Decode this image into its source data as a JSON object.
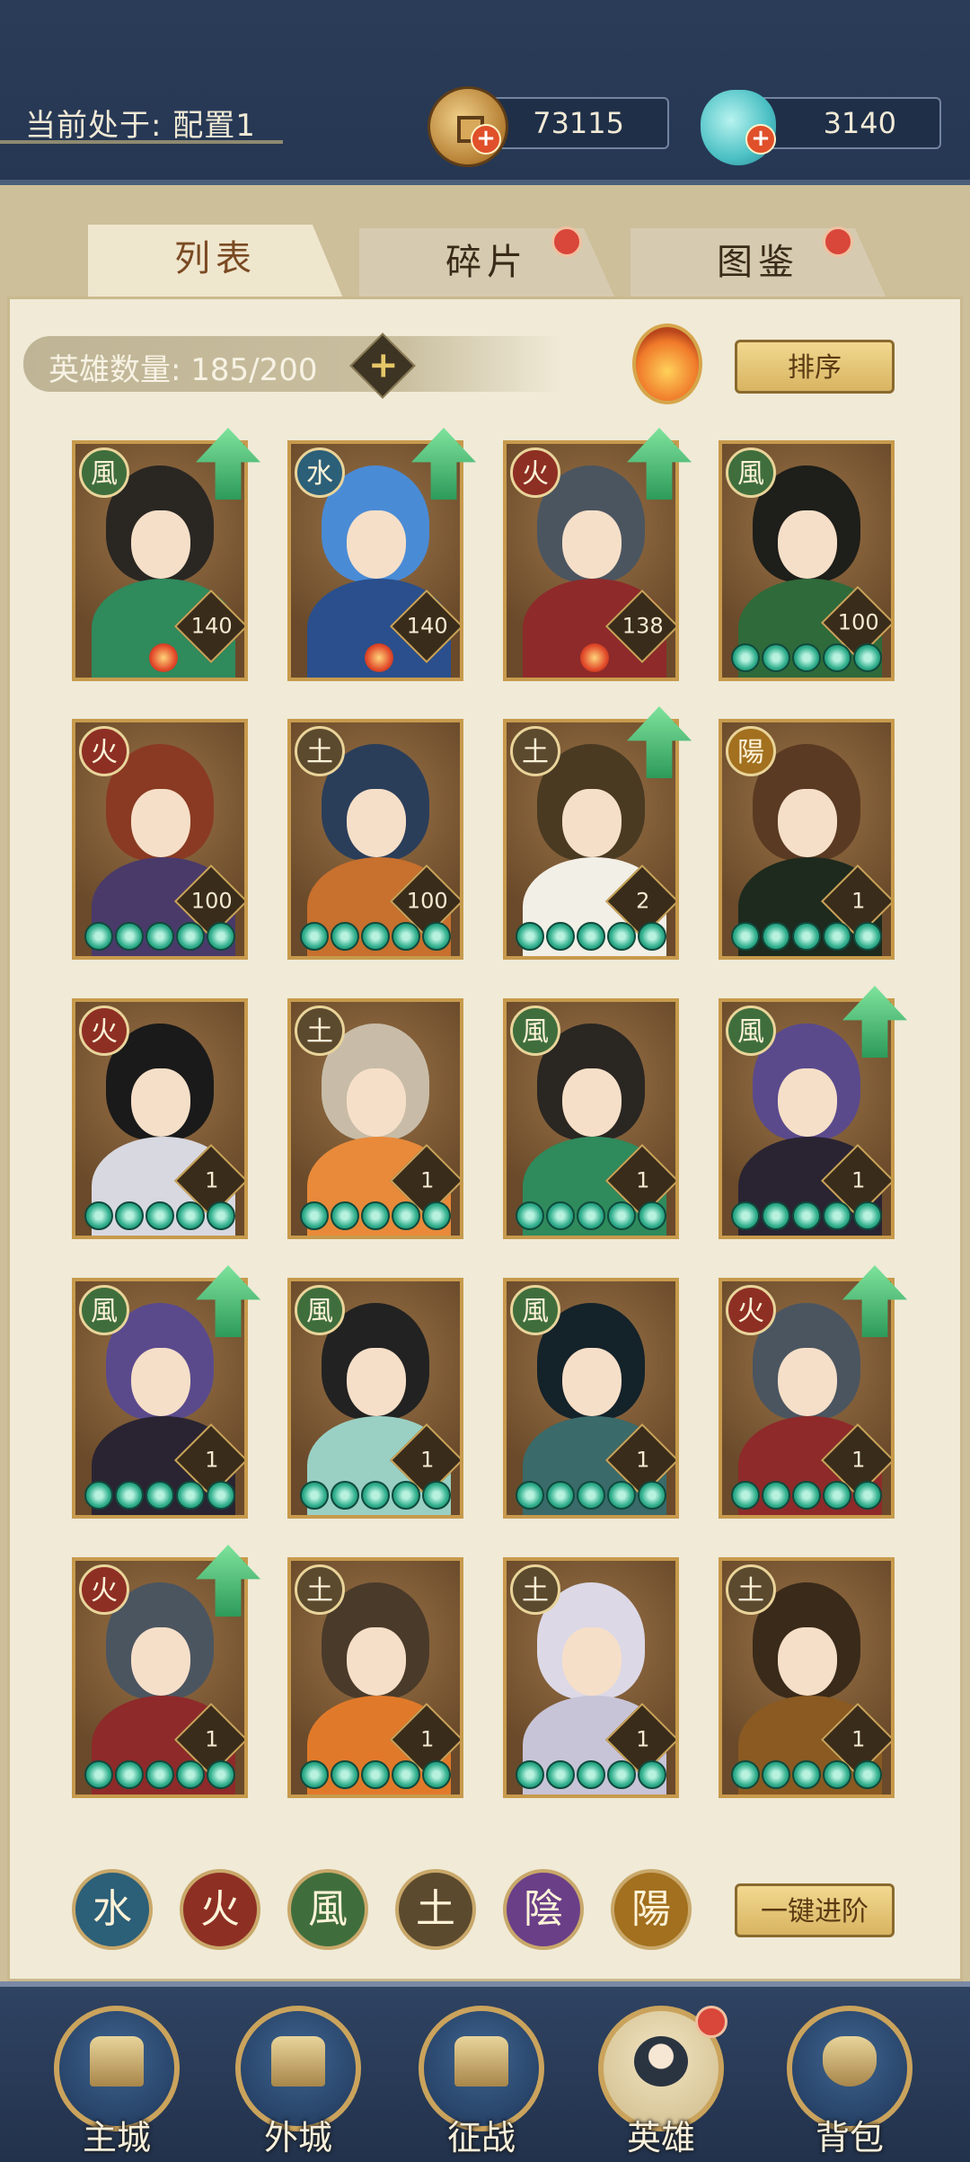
{
  "header": {
    "config_label": "当前处于: 配置1",
    "copper": "73115",
    "jade": "3140"
  },
  "tabs": [
    {
      "label": "列表",
      "active": true,
      "has_dot": false
    },
    {
      "label": "碎片",
      "active": false,
      "has_dot": true
    },
    {
      "label": "图鉴",
      "active": false,
      "has_dot": true
    }
  ],
  "toolbar": {
    "hero_count": "英雄数量: 185/200",
    "add_symbol": "+",
    "sort_label": "排序"
  },
  "element_glyphs": {
    "wood": "風",
    "water": "水",
    "fire": "火",
    "earth": "土",
    "yang": "陽",
    "yin": "陰"
  },
  "heroes": [
    {
      "element": "wood",
      "level": "140",
      "upgrade": true,
      "stars": 0,
      "weapon": true,
      "hair": "#2a2622",
      "body": "#2f8a5c"
    },
    {
      "element": "water",
      "level": "140",
      "upgrade": true,
      "stars": 0,
      "weapon": true,
      "hair": "#4a8bd6",
      "body": "#2a4f8c"
    },
    {
      "element": "fire",
      "level": "138",
      "upgrade": true,
      "stars": 0,
      "weapon": true,
      "hair": "#4b5560",
      "body": "#8e2a2a"
    },
    {
      "element": "wood",
      "level": "100",
      "upgrade": false,
      "stars": 5,
      "weapon": false,
      "hair": "#1e1e1a",
      "body": "#2f6a3a"
    },
    {
      "element": "fire",
      "level": "100",
      "upgrade": false,
      "stars": 5,
      "weapon": false,
      "hair": "#8a3a22",
      "body": "#4a3a6a"
    },
    {
      "element": "earth",
      "level": "100",
      "upgrade": false,
      "stars": 5,
      "weapon": false,
      "hair": "#2a3e5a",
      "body": "#c8702e"
    },
    {
      "element": "earth",
      "level": "2",
      "upgrade": true,
      "stars": 5,
      "weapon": false,
      "hair": "#4a3a22",
      "body": "#f2efe6"
    },
    {
      "element": "yang",
      "level": "1",
      "upgrade": false,
      "stars": 5,
      "weapon": false,
      "hair": "#5a3a22",
      "body": "#1e2a1e"
    },
    {
      "element": "fire",
      "level": "1",
      "upgrade": false,
      "stars": 5,
      "weapon": false,
      "hair": "#1a1a1a",
      "body": "#d8d8e0"
    },
    {
      "element": "earth",
      "level": "1",
      "upgrade": false,
      "stars": 5,
      "weapon": false,
      "hair": "#c8bca8",
      "body": "#e88a3a"
    },
    {
      "element": "wood",
      "level": "1",
      "upgrade": false,
      "stars": 5,
      "weapon": false,
      "hair": "#2a2622",
      "body": "#2f8a5c"
    },
    {
      "element": "wood",
      "level": "1",
      "upgrade": true,
      "stars": 5,
      "weapon": false,
      "hair": "#5a4a8c",
      "body": "#2a2432"
    },
    {
      "element": "wood",
      "level": "1",
      "upgrade": true,
      "stars": 5,
      "weapon": false,
      "hair": "#5a4a8c",
      "body": "#2a2432"
    },
    {
      "element": "wood",
      "level": "1",
      "upgrade": false,
      "stars": 5,
      "weapon": false,
      "hair": "#222222",
      "body": "#9ad0c4"
    },
    {
      "element": "wood",
      "level": "1",
      "upgrade": false,
      "stars": 5,
      "weapon": false,
      "hair": "#14222a",
      "body": "#3a6a6a"
    },
    {
      "element": "fire",
      "level": "1",
      "upgrade": true,
      "stars": 5,
      "weapon": false,
      "hair": "#4b5560",
      "body": "#8e2a2a"
    },
    {
      "element": "fire",
      "level": "1",
      "upgrade": true,
      "stars": 5,
      "weapon": false,
      "hair": "#4b5560",
      "body": "#8e2a2a"
    },
    {
      "element": "earth",
      "level": "1",
      "upgrade": false,
      "stars": 5,
      "weapon": false,
      "hair": "#4a3a2a",
      "body": "#e07a2a"
    },
    {
      "element": "earth",
      "level": "1",
      "upgrade": false,
      "stars": 5,
      "weapon": false,
      "hair": "#dcd8e6",
      "body": "#c8c4d8"
    },
    {
      "element": "earth",
      "level": "1",
      "upgrade": false,
      "stars": 5,
      "weapon": false,
      "hair": "#3a2a1a",
      "body": "#8a5a22"
    }
  ],
  "filters": [
    {
      "element": "water",
      "glyph": "水"
    },
    {
      "element": "fire",
      "glyph": "火"
    },
    {
      "element": "wood",
      "glyph": "風"
    },
    {
      "element": "earth",
      "glyph": "土"
    },
    {
      "element": "yin",
      "glyph": "陰"
    },
    {
      "element": "yang",
      "glyph": "陽"
    }
  ],
  "advance_label": "一键进阶",
  "nav": [
    {
      "label": "主城",
      "icon": "palace-icon",
      "active": false
    },
    {
      "label": "外城",
      "icon": "city-gate-icon",
      "active": false
    },
    {
      "label": "征战",
      "icon": "war-horn-icon",
      "active": false
    },
    {
      "label": "英雄",
      "icon": "hero-portrait-icon",
      "active": true
    },
    {
      "label": "背包",
      "icon": "bag-icon",
      "active": false
    }
  ],
  "colors": {
    "accent_gold": "#caa35c",
    "panel": "#f0ead7",
    "nav_bg": "#2f4362",
    "badge_red": "#d9463a"
  }
}
